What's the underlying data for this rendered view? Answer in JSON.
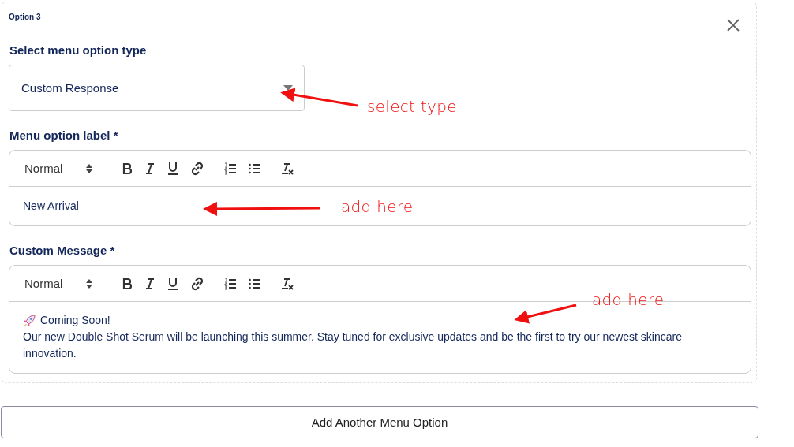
{
  "option_title": "Option 3",
  "type_field": {
    "label": "Select menu option type",
    "value": "Custom Response"
  },
  "editors": [
    {
      "label": "Menu option label *",
      "format": "Normal",
      "lines": [
        {
          "kind": "text",
          "text": "New Arrival"
        }
      ]
    },
    {
      "label": "Custom Message *",
      "format": "Normal",
      "lines": [
        {
          "kind": "rocket",
          "text": "Coming Soon!"
        },
        {
          "kind": "text",
          "text": "Our new Double Shot Serum will be launching this summer. Stay tuned for exclusive updates and be the first to try our newest skincare innovation."
        }
      ]
    }
  ],
  "add_button": "Add Another Menu Option",
  "annotations": [
    {
      "text": "select type"
    },
    {
      "text": "add here"
    },
    {
      "text": "add here"
    }
  ]
}
